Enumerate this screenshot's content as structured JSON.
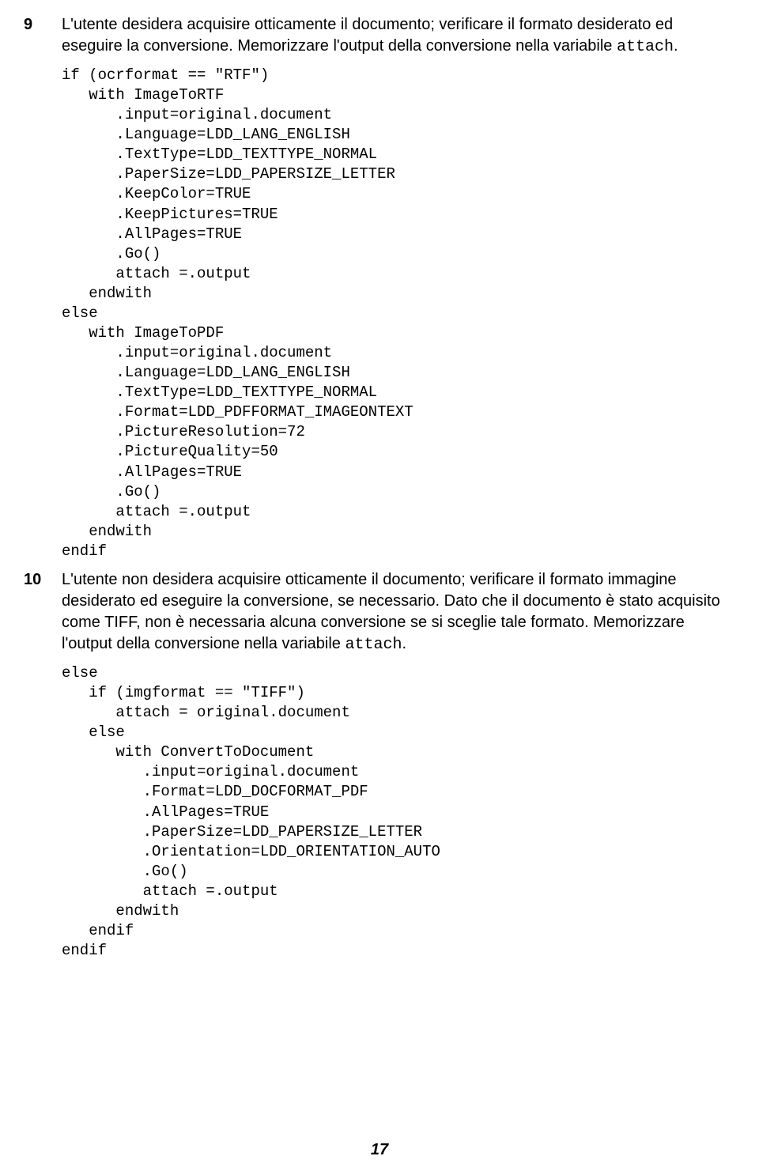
{
  "step9": {
    "num": "9",
    "text_before": "L'utente desidera acquisire otticamente il documento; verificare il formato desiderato ed eseguire la conversione. Memorizzare l'output della conversione nella variabile ",
    "code_inline": "attach",
    "text_after": "."
  },
  "code1": "if (ocrformat == \"RTF\")\n   with ImageToRTF\n      .input=original.document\n      .Language=LDD_LANG_ENGLISH\n      .TextType=LDD_TEXTTYPE_NORMAL\n      .PaperSize=LDD_PAPERSIZE_LETTER\n      .KeepColor=TRUE\n      .KeepPictures=TRUE\n      .AllPages=TRUE\n      .Go()\n      attach =.output\n   endwith\nelse\n   with ImageToPDF\n      .input=original.document\n      .Language=LDD_LANG_ENGLISH\n      .TextType=LDD_TEXTTYPE_NORMAL\n      .Format=LDD_PDFFORMAT_IMAGEONTEXT\n      .PictureResolution=72\n      .PictureQuality=50\n      .AllPages=TRUE\n      .Go()\n      attach =.output\n   endwith\nendif",
  "step10": {
    "num": "10",
    "text_before": "L'utente non desidera acquisire otticamente il documento; verificare il formato immagine desiderato ed eseguire la conversione, se necessario. Dato che il documento è stato acquisito come TIFF, non è necessaria alcuna conversione se si sceglie tale formato. Memorizzare l'output della conversione nella variabile ",
    "code_inline": "attach",
    "text_after": "."
  },
  "code2": "else\n   if (imgformat == \"TIFF\")\n      attach = original.document\n   else\n      with ConvertToDocument\n         .input=original.document\n         .Format=LDD_DOCFORMAT_PDF\n         .AllPages=TRUE\n         .PaperSize=LDD_PAPERSIZE_LETTER\n         .Orientation=LDD_ORIENTATION_AUTO\n         .Go()\n         attach =.output\n      endwith\n   endif\nendif",
  "page_number": "17"
}
